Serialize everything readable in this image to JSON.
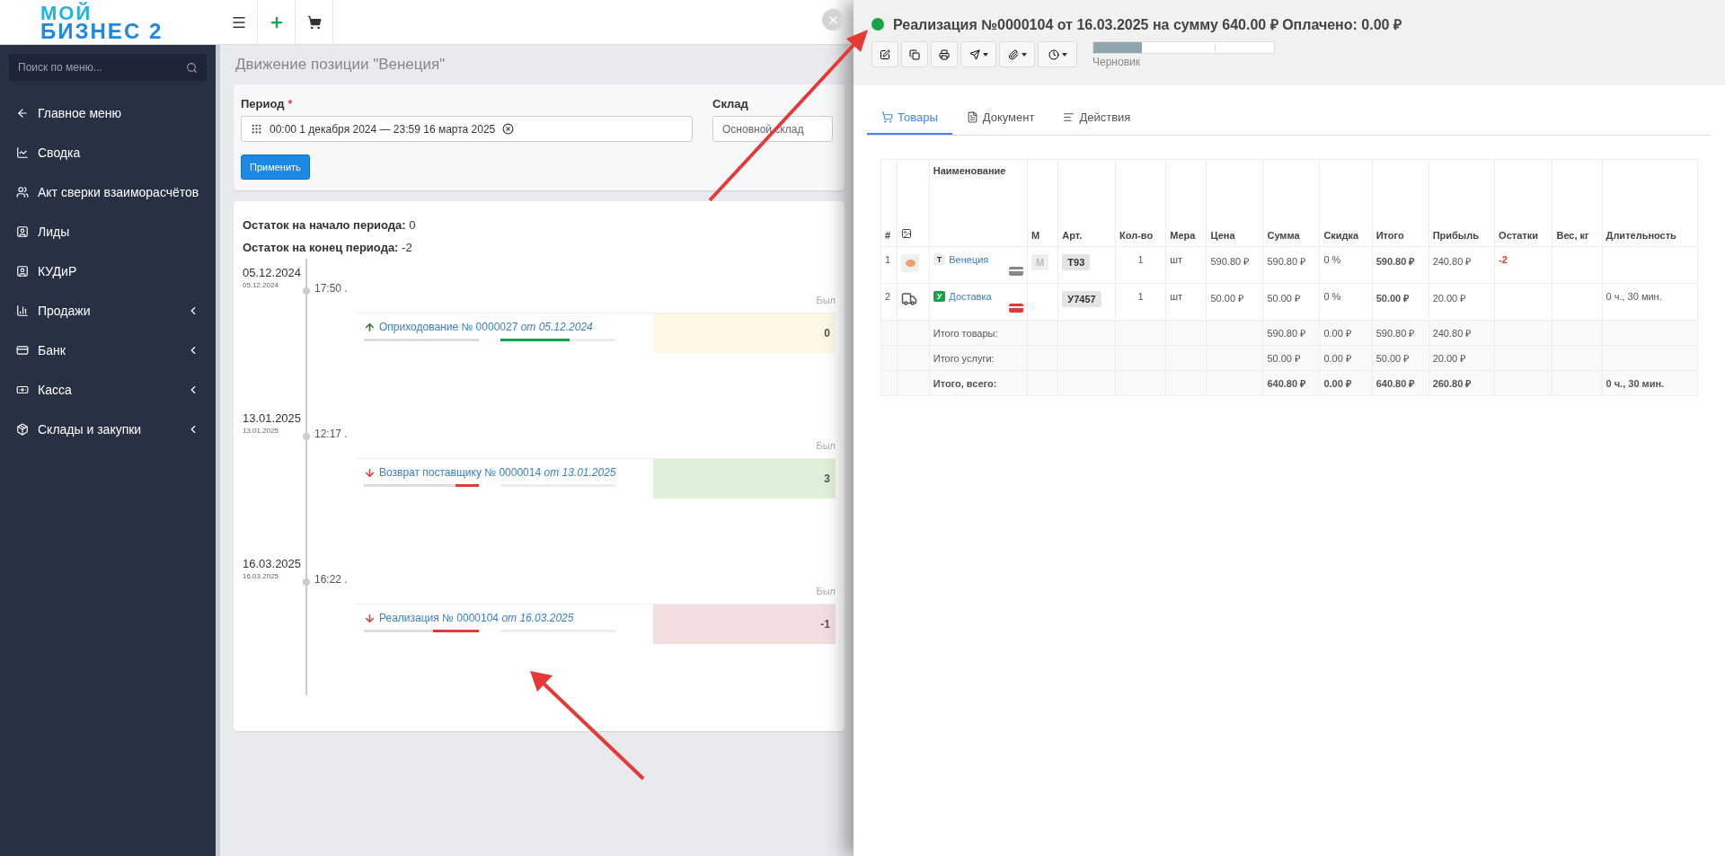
{
  "header": {
    "logo_lines": [
      "МОЙ",
      "БИЗНЕС 2"
    ]
  },
  "sidebar": {
    "search": {
      "placeholder": "Поиск по меню..."
    },
    "items": [
      {
        "label": "Главное меню",
        "has_children": false
      },
      {
        "label": "Сводка",
        "has_children": false
      },
      {
        "label": "Акт сверки взаиморасчётов",
        "has_children": false
      },
      {
        "label": "Лиды",
        "has_children": false
      },
      {
        "label": "КУДиР",
        "has_children": false
      },
      {
        "label": "Продажи",
        "has_children": true
      },
      {
        "label": "Банк",
        "has_children": true
      },
      {
        "label": "Касса",
        "has_children": true
      },
      {
        "label": "Склады и закупки",
        "has_children": true
      }
    ]
  },
  "page": {
    "title": "Движение позиции \"Венеция\"",
    "filter": {
      "period_label": "Период",
      "required_mark": "*",
      "period_value": "00:00 1 декабря 2024 — 23:59 16 марта 2025",
      "warehouse_label": "Склад",
      "warehouse_value": "Основной склад",
      "apply_button": "Применить"
    },
    "summary": [
      {
        "label": "Остаток на начало периода:",
        "value": "0"
      },
      {
        "label": "Остаток на конец периода:",
        "value": "-2"
      }
    ],
    "timeline": [
      {
        "date": "05.12.2024",
        "date_small": "05.12.2024",
        "time": "17:50 .",
        "prev_label": "Был",
        "kind": "in",
        "doc": "Оприходование № 0000027 *от 05.12.2024*",
        "level": 0.6,
        "value": "0",
        "color": "#fcf8e3"
      },
      {
        "date": "13.01.2025",
        "date_small": "13.01.2025",
        "time": "12:17 .",
        "prev_label": "Был",
        "kind": "out",
        "doc": "Возврат поставщику № 0000014 *от 13.01.2025*",
        "level": 0.2,
        "value": "3",
        "color": "#dff0d8"
      },
      {
        "date": "16.03.2025",
        "date_small": "16.03.2025",
        "time": "16:22 .",
        "prev_label": "Был",
        "kind": "out",
        "doc": "Реализация № 0000104 *от 16.03.2025*",
        "level": 0.4,
        "value": "-1",
        "color": "#f2dede"
      }
    ]
  },
  "panel": {
    "title": "Реализация №0000104 от 16.03.2025 на сумму 640.00 ₽ Оплачено: 0.00 ₽",
    "status": {
      "color": "#16a34a",
      "level": 0.27,
      "label": "Черновик"
    },
    "tabs": [
      {
        "label": "Товары",
        "selected": true
      },
      {
        "label": "Документ",
        "selected": false
      },
      {
        "label": "Действия",
        "selected": false
      }
    ],
    "table": {
      "columns": [
        {
          "label": "#"
        },
        {
          "kind": "image"
        },
        {
          "label": "Наименование"
        },
        {
          "label": "М"
        },
        {
          "label": "Арт."
        },
        {
          "label": "Кол-во"
        },
        {
          "label": "Мера"
        },
        {
          "label": "Цена"
        },
        {
          "label": "Сумма"
        },
        {
          "label": "Скидка"
        },
        {
          "label": "Итого"
        },
        {
          "label": "Прибыль"
        },
        {
          "label": "Остатки"
        },
        {
          "label": "Вес, кг"
        },
        {
          "label": "Длительность"
        }
      ],
      "rows": [
        {
          "num": "1",
          "kind": "goods",
          "type_badge": "Т",
          "name": "Венеция",
          "m_badge": "М",
          "sku": "Т93",
          "qty": "1",
          "unit": "шт",
          "price": "590.80 ₽",
          "sum": "590.80 ₽",
          "discount": "0 %",
          "total": "590.80 ₽",
          "profit": "240.80 ₽",
          "stock": "-2"
        },
        {
          "num": "2",
          "kind": "service",
          "type_badge": "У",
          "name": "Доставка",
          "sku": "У7457",
          "qty": "1",
          "unit": "шт",
          "price": "50.00 ₽",
          "sum": "50.00 ₽",
          "discount": "0 %",
          "total": "50.00 ₽",
          "profit": "20.00 ₽",
          "duration": "0 ч., 30 мин."
        }
      ],
      "totals": [
        {
          "label": "Итого товары:",
          "bold": false,
          "sum": "590.80 ₽",
          "discount": "0.00 ₽",
          "total": "590.80 ₽",
          "profit": "240.80 ₽"
        },
        {
          "label": "Итого услуги:",
          "bold": false,
          "sum": "50.00 ₽",
          "discount": "0.00 ₽",
          "total": "50.00 ₽",
          "profit": "20.00 ₽"
        },
        {
          "label": "Итого, всего:",
          "bold": true,
          "sum": "640.80 ₽",
          "discount": "0.00 ₽",
          "total": "640.80 ₽",
          "profit": "260.80 ₽",
          "duration": "0 ч., 30 мин."
        }
      ]
    }
  }
}
